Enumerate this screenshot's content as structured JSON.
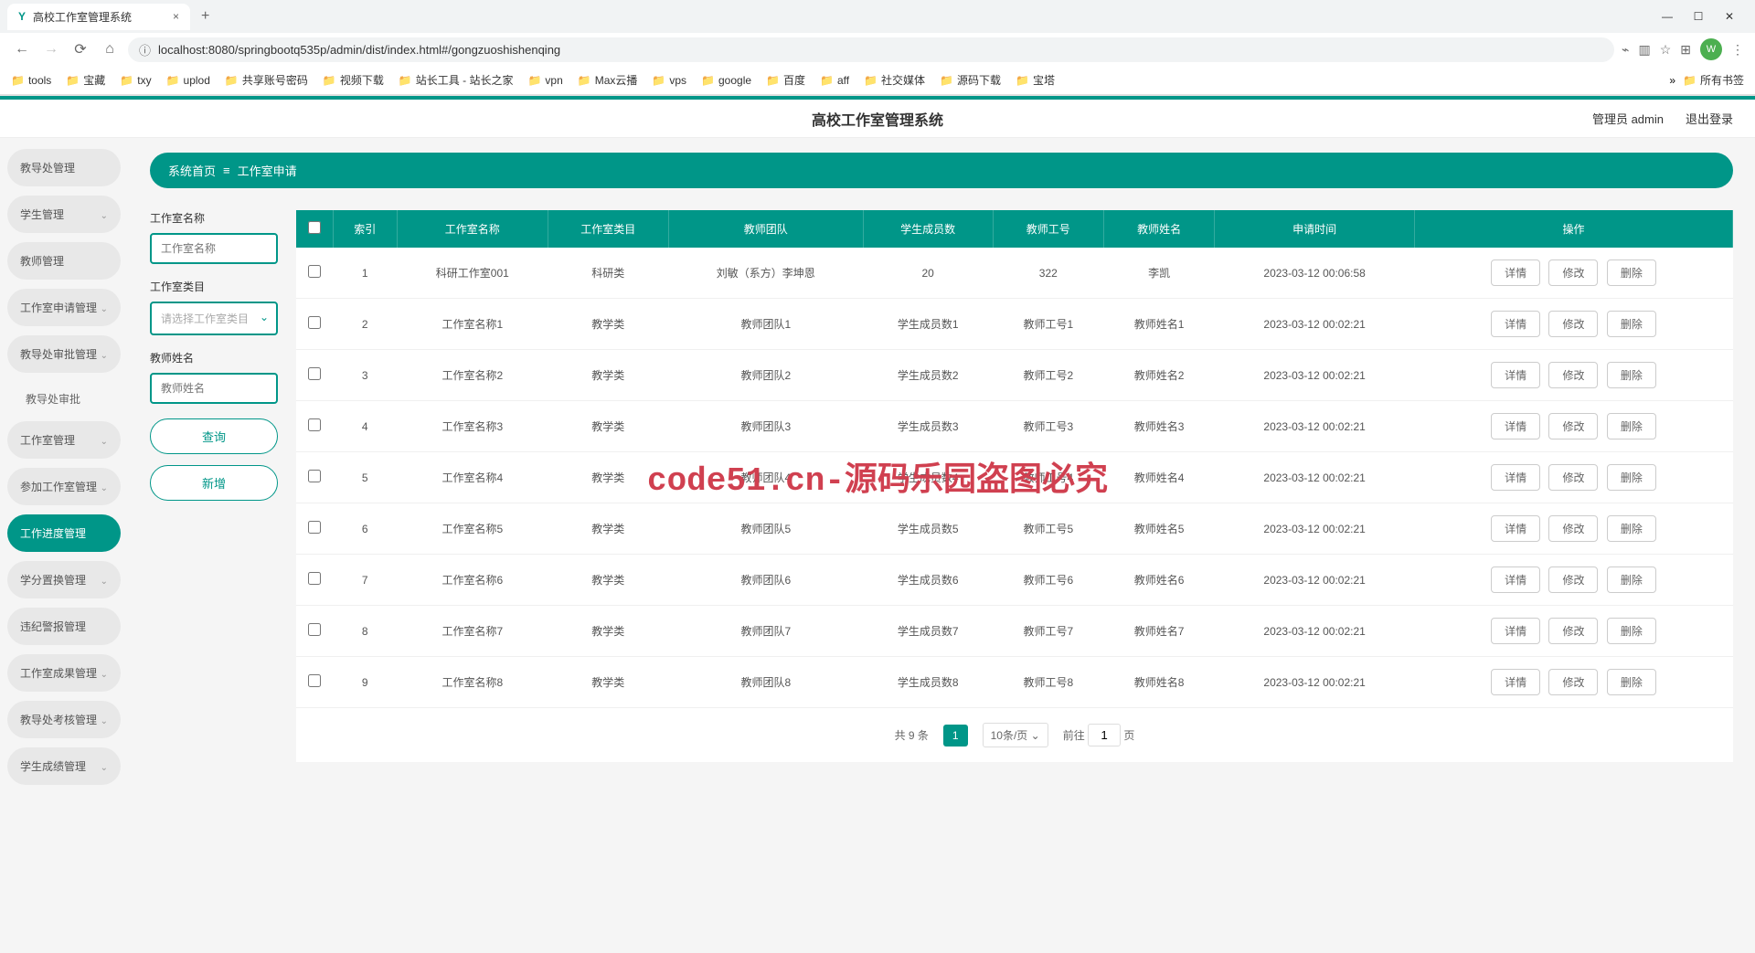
{
  "browser": {
    "tab_title": "高校工作室管理系统",
    "url": "localhost:8080/springbootq535p/admin/dist/index.html#/gongzuoshishenqing",
    "avatar_letter": "W",
    "bookmarks": [
      "tools",
      "宝藏",
      "txy",
      "uplod",
      "共享账号密码",
      "视频下载",
      "站长工具 - 站长之家",
      "vpn",
      "Max云播",
      "vps",
      "google",
      "百度",
      "aff",
      "社交媒体",
      "源码下载",
      "宝塔"
    ],
    "all_bookmarks": "所有书签"
  },
  "header": {
    "title": "高校工作室管理系统",
    "user": "管理员 admin",
    "logout": "退出登录"
  },
  "sidebar": {
    "items": [
      {
        "label": "教导处管理",
        "chev": false
      },
      {
        "label": "学生管理",
        "chev": true
      },
      {
        "label": "教师管理",
        "chev": false
      },
      {
        "label": "工作室申请管理",
        "chev": true
      },
      {
        "label": "教导处审批管理",
        "chev": true
      },
      {
        "label": "工作室管理",
        "chev": true
      },
      {
        "label": "参加工作室管理",
        "chev": true
      },
      {
        "label": "工作进度管理",
        "chev": false,
        "active": true
      },
      {
        "label": "学分置换管理",
        "chev": true
      },
      {
        "label": "违纪警报管理",
        "chev": false
      },
      {
        "label": "工作室成果管理",
        "chev": true
      },
      {
        "label": "教导处考核管理",
        "chev": true
      },
      {
        "label": "学生成绩管理",
        "chev": true
      }
    ],
    "sub_item": "教导处审批"
  },
  "breadcrumb": {
    "home": "系统首页",
    "sep": "≡",
    "current": "工作室申请"
  },
  "search": {
    "label_name": "工作室名称",
    "ph_name": "工作室名称",
    "label_type": "工作室类目",
    "ph_type": "请选择工作室类目",
    "label_teacher": "教师姓名",
    "ph_teacher": "教师姓名",
    "btn_query": "查询",
    "btn_add": "新增"
  },
  "table": {
    "headers": [
      "索引",
      "工作室名称",
      "工作室类目",
      "教师团队",
      "学生成员数",
      "教师工号",
      "教师姓名",
      "申请时间",
      "操作"
    ],
    "op_detail": "详情",
    "op_edit": "修改",
    "op_delete": "删除",
    "rows": [
      {
        "idx": "1",
        "name": "科研工作室001",
        "type": "科研类",
        "team": "刘敏（系方）李坤恩",
        "count": "20",
        "tno": "322",
        "tname": "李凯",
        "time": "2023-03-12 00:06:58"
      },
      {
        "idx": "2",
        "name": "工作室名称1",
        "type": "教学类",
        "team": "教师团队1",
        "count": "学生成员数1",
        "tno": "教师工号1",
        "tname": "教师姓名1",
        "time": "2023-03-12 00:02:21"
      },
      {
        "idx": "3",
        "name": "工作室名称2",
        "type": "教学类",
        "team": "教师团队2",
        "count": "学生成员数2",
        "tno": "教师工号2",
        "tname": "教师姓名2",
        "time": "2023-03-12 00:02:21"
      },
      {
        "idx": "4",
        "name": "工作室名称3",
        "type": "教学类",
        "team": "教师团队3",
        "count": "学生成员数3",
        "tno": "教师工号3",
        "tname": "教师姓名3",
        "time": "2023-03-12 00:02:21"
      },
      {
        "idx": "5",
        "name": "工作室名称4",
        "type": "教学类",
        "team": "教师团队4",
        "count": "学生成员数4",
        "tno": "教师工号4",
        "tname": "教师姓名4",
        "time": "2023-03-12 00:02:21"
      },
      {
        "idx": "6",
        "name": "工作室名称5",
        "type": "教学类",
        "team": "教师团队5",
        "count": "学生成员数5",
        "tno": "教师工号5",
        "tname": "教师姓名5",
        "time": "2023-03-12 00:02:21"
      },
      {
        "idx": "7",
        "name": "工作室名称6",
        "type": "教学类",
        "team": "教师团队6",
        "count": "学生成员数6",
        "tno": "教师工号6",
        "tname": "教师姓名6",
        "time": "2023-03-12 00:02:21"
      },
      {
        "idx": "8",
        "name": "工作室名称7",
        "type": "教学类",
        "team": "教师团队7",
        "count": "学生成员数7",
        "tno": "教师工号7",
        "tname": "教师姓名7",
        "time": "2023-03-12 00:02:21"
      },
      {
        "idx": "9",
        "name": "工作室名称8",
        "type": "教学类",
        "team": "教师团队8",
        "count": "学生成员数8",
        "tno": "教师工号8",
        "tname": "教师姓名8",
        "time": "2023-03-12 00:02:21"
      }
    ]
  },
  "pagination": {
    "total": "共 9 条",
    "page": "1",
    "size": "10条/页",
    "goto": "前往",
    "goto_val": "1",
    "page_unit": "页"
  },
  "watermark": "code51.cn-源码乐园盗图必究"
}
